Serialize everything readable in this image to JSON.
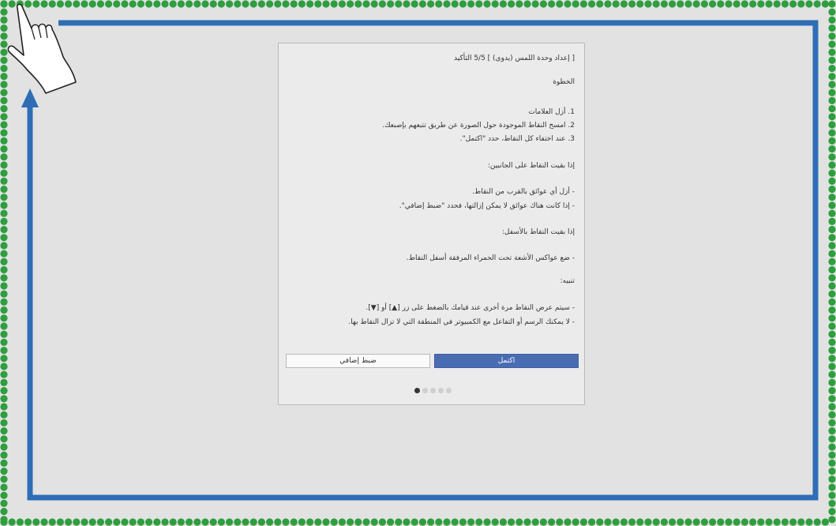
{
  "dialog": {
    "title": "[ إعداد وحدة اللمس (يدوي) ]  5/5 التأكيد",
    "step_heading": "الخطوة",
    "steps": [
      "1. أزل العلامات",
      "2. امسح النقاط الموجودة حول الصورة عن طريق تتبعهم بإصبعك.",
      "3. عند اختفاء كل النقاط، حدد \"اكتمل\"."
    ],
    "sides_heading": "إذا بقيت النقاط على الجانبين:",
    "sides_items": [
      "- أزل أي عوائق بالقرب من النقاط.",
      "- إذا كانت هناك عوائق لا يمكن إزالتها، فحدد \"ضبط إضافي\"."
    ],
    "bottom_heading": "إذا بقيت النقاط بالأسفل:",
    "bottom_items": [
      "- ضع عواكس الأشعة تحت الحمراء المرفقة أسفل النقاط."
    ],
    "notice_heading": "تنبيه:",
    "notice_items": [
      "- سيتم عرض النقاط مرة أخرى عند قيامك بالضغط على زر [▲] أو [▼].",
      "- لا يمكنك الرسم أو التفاعل مع الكمبيوتر في المنطقة التي لا تزال النقاط بها."
    ],
    "complete_label": "اكتمل",
    "extra_label": "ضبط إضافي",
    "page_current": 1,
    "page_total": 5
  },
  "colors": {
    "dots": "#2e9e3e",
    "arrow": "#2f6db5",
    "primary": "#4a6cb3",
    "screen": "#e2e2e2"
  },
  "icons": {
    "hand": "pointing-hand-icon",
    "arrow": "trace-arrow-icon"
  }
}
